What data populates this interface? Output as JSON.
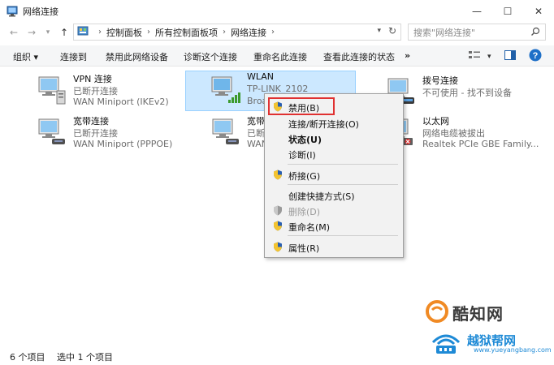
{
  "window": {
    "title": "网络连接",
    "controls": {
      "minimize": "—",
      "maximize": "☐",
      "close": "✕"
    }
  },
  "address": {
    "path": [
      "控制面板",
      "所有控制面板项",
      "网络连接"
    ],
    "search_placeholder": "搜索\"网络连接\""
  },
  "toolbar": {
    "organize": "组织 ▾",
    "connect_to": "连接到",
    "disable_device": "禁用此网络设备",
    "diagnose": "诊断这个连接",
    "rename": "重命名此连接",
    "view_status": "查看此连接的状态",
    "more": "»"
  },
  "connections": [
    {
      "name": "VPN 连接",
      "status": "已断开连接",
      "device": "WAN Miniport (IKEv2)"
    },
    {
      "name": "WLAN",
      "status": "TP-LINK_2102",
      "device": "Broa"
    },
    {
      "name": "拨号连接",
      "status": "不可使用 - 找不到设备",
      "device": ""
    },
    {
      "name": "宽带连接",
      "status": "已断开连接",
      "device": "WAN Miniport (PPPOE)"
    },
    {
      "name": "宽带",
      "status": "已断",
      "device": "WAN"
    },
    {
      "name": "以太网",
      "status": "网络电缆被拔出",
      "device": "Realtek PCIe GBE Family..."
    }
  ],
  "context_menu": {
    "items": [
      {
        "label": "禁用(B)"
      },
      {
        "label": "连接/断开连接(O)"
      },
      {
        "label": "状态(U)"
      },
      {
        "label": "诊断(I)"
      },
      {
        "label": "桥接(G)"
      },
      {
        "label": "创建快捷方式(S)"
      },
      {
        "label": "删除(D)"
      },
      {
        "label": "重命名(M)"
      },
      {
        "label": "属性(R)"
      }
    ]
  },
  "statusbar": {
    "item_count": "6 个项目",
    "selected": "选中 1 个项目"
  },
  "watermarks": {
    "brand1": "酷知网",
    "brand2": "越狱帮网",
    "url": "www.yueyangbang.com"
  },
  "colors": {
    "accent": "#1e8ad6",
    "selection": "#cce8ff",
    "highlight": "#e03131"
  }
}
